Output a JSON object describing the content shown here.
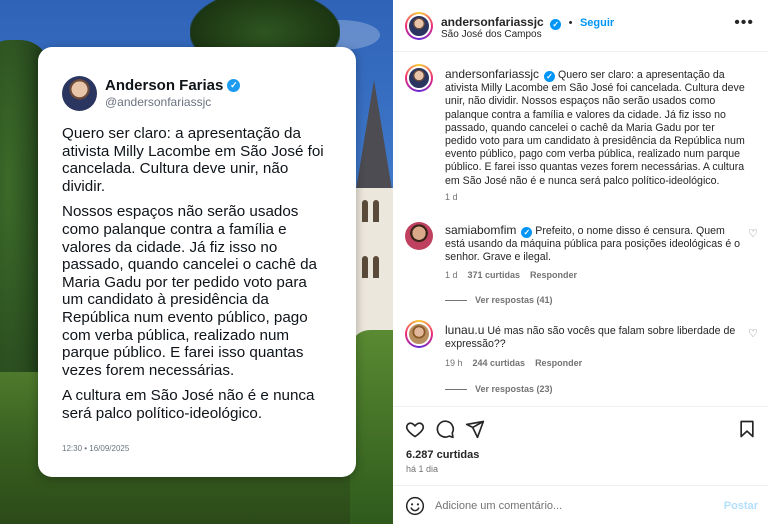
{
  "card": {
    "name": "Anderson Farias",
    "handle": "@andersonfariassjc",
    "paragraphs": [
      "Quero ser claro: a apresentação da ativista Milly Lacombe em São José foi cancelada. Cultura deve unir, não dividir.",
      "Nossos espaços não serão usados como palanque contra a família e valores da cidade. Já fiz isso no passado, quando cancelei o cachê da Maria Gadu por ter pedido voto para um candidato à presidência da República num evento público, pago com verba pública, realizado num parque público. E farei isso quantas vezes forem necessárias.",
      "A cultura em São José não é e nunca será palco político-ideológico."
    ],
    "date": "12:30 • 16/09/2025"
  },
  "header": {
    "username": "andersonfariassjc",
    "follow_label": "Seguir",
    "location": "São José dos Campos",
    "separator": "•"
  },
  "caption": {
    "username": "andersonfariassjc",
    "text": "Quero ser claro: a apresentação da ativista Milly Lacombe em São José foi cancelada. Cultura deve unir, não dividir. Nossos espaços não serão usados como palanque contra a família e valores da cidade. Já fiz isso no passado, quando cancelei o cachê da Maria Gadu por ter pedido voto para um candidato à presidência da República num evento público, pago com verba pública, realizado num parque público. E farei isso quantas vezes forem necessárias. A cultura em São José não é e nunca será palco político-ideológico.",
    "time": "1 d"
  },
  "comments": [
    {
      "username": "samiabomfim",
      "verified": true,
      "text": "Prefeito, o nome disso é censura. Quem está usando da máquina pública para posições ideológicas é o senhor. Grave e ilegal.",
      "time": "1 d",
      "likes": "371 curtidas",
      "reply_label": "Responder",
      "view_replies": "Ver respostas (41)"
    },
    {
      "username": "lunau.u",
      "verified": false,
      "text": "Ué mas não são vocês que falam sobre liberdade de expressão??",
      "time": "19 h",
      "likes": "244 curtidas",
      "reply_label": "Responder",
      "view_replies": "Ver respostas (23)"
    }
  ],
  "stats": {
    "likes": "6.287 curtidas",
    "ago": "há 1 dia"
  },
  "add_comment": {
    "placeholder": "Adicione um comentário...",
    "post_label": "Postar"
  },
  "icons": {
    "heart": "heart-icon",
    "comment": "comment-icon",
    "share": "share-icon",
    "save": "bookmark-icon",
    "more": "more-options-icon",
    "emoji": "emoji-icon",
    "verified": "verified-badge-icon"
  },
  "colors": {
    "link_blue": "#0095f6",
    "verified_blue": "#1d9bf0",
    "text": "#262626",
    "muted": "#737373"
  }
}
